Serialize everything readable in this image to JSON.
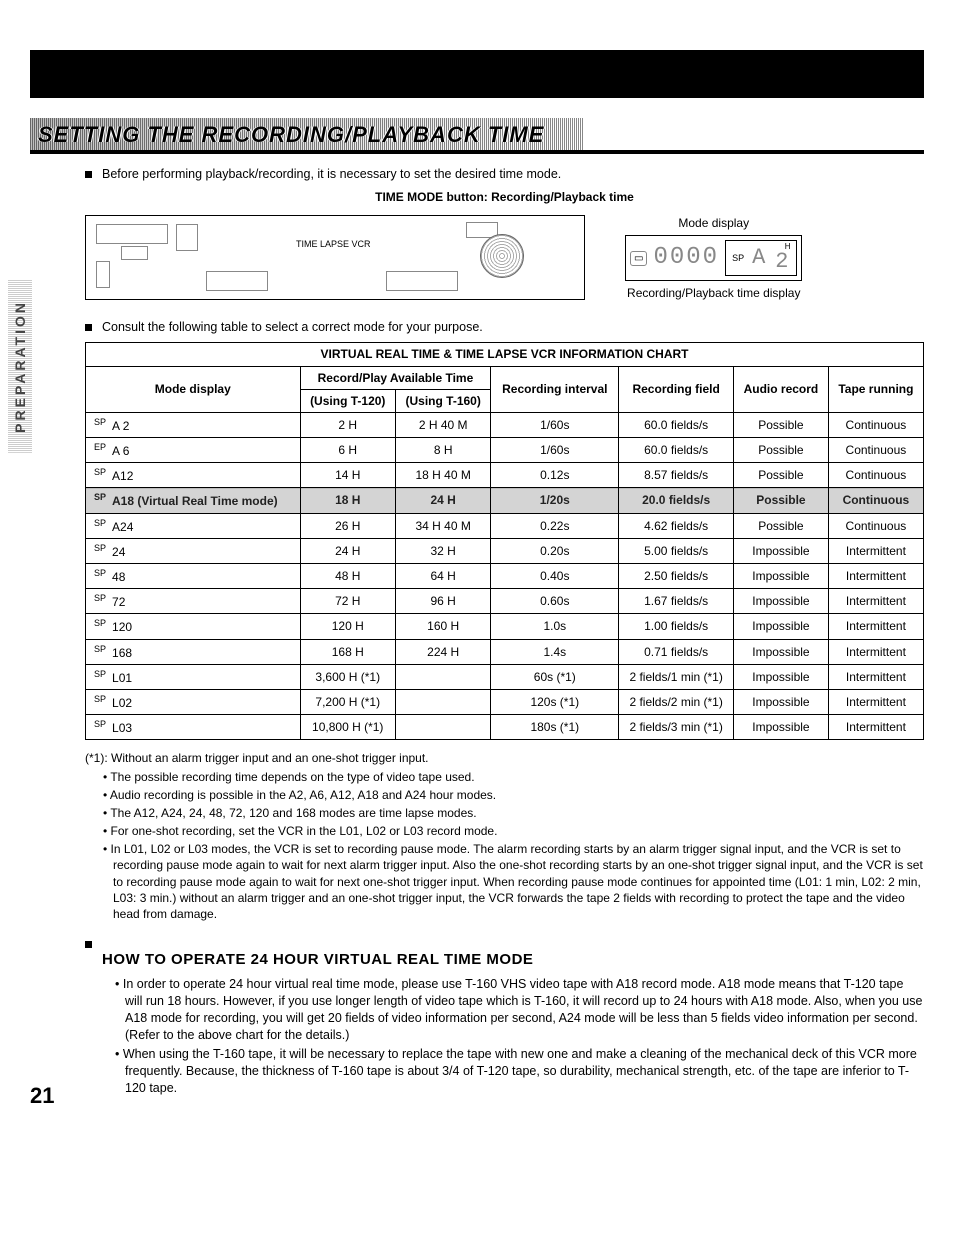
{
  "side_tab": "PREPARATION",
  "section_title": "SETTING THE RECORDING/PLAYBACK TIME",
  "intro1": "Before performing playback/recording, it is necessary to set the desired time mode.",
  "time_mode_line": "TIME MODE button: Recording/Playback time",
  "vcr_label": "TIME LAPSE VCR",
  "mode_display_label": "Mode display",
  "mode_display_segments": "0000",
  "mode_display_sp": "SP",
  "mode_display_a": "A",
  "mode_display_2": "2",
  "mode_display_h": "H",
  "mode_display_caption": "Recording/Playback time display",
  "intro2": "Consult the following table to select a correct mode for your purpose.",
  "table": {
    "title": "VIRTUAL REAL TIME & TIME LAPSE VCR INFORMATION CHART",
    "head_mode": "Mode display",
    "head_avail": "Record/Play Available Time",
    "head_t120": "(Using T-120)",
    "head_t160": "(Using T-160)",
    "head_interval": "Recording interval",
    "head_field": "Recording field",
    "head_audio": "Audio record",
    "head_tape": "Tape running",
    "rows": [
      {
        "sp": "SP",
        "mode": "A 2",
        "t120": "2 H",
        "t160": "2 H 40 M",
        "interval": "1/60s",
        "field": "60.0 fields/s",
        "audio": "Possible",
        "tape": "Continuous"
      },
      {
        "sp": "EP",
        "mode": "A 6",
        "t120": "6 H",
        "t160": "8 H",
        "interval": "1/60s",
        "field": "60.0 fields/s",
        "audio": "Possible",
        "tape": "Continuous"
      },
      {
        "sp": "SP",
        "mode": "A12",
        "t120": "14 H",
        "t160": "18 H 40 M",
        "interval": "0.12s",
        "field": "8.57 fields/s",
        "audio": "Possible",
        "tape": "Continuous"
      },
      {
        "sp": "SP",
        "mode": "A18 (Virtual Real Time mode)",
        "t120": "18 H",
        "t160": "24 H",
        "interval": "1/20s",
        "field": "20.0 fields/s",
        "audio": "Possible",
        "tape": "Continuous",
        "hl": true
      },
      {
        "sp": "SP",
        "mode": "A24",
        "t120": "26 H",
        "t160": "34 H 40 M",
        "interval": "0.22s",
        "field": "4.62 fields/s",
        "audio": "Possible",
        "tape": "Continuous"
      },
      {
        "sp": "SP",
        "mode": "24",
        "t120": "24 H",
        "t160": "32 H",
        "interval": "0.20s",
        "field": "5.00 fields/s",
        "audio": "Impossible",
        "tape": "Intermittent"
      },
      {
        "sp": "SP",
        "mode": "48",
        "t120": "48 H",
        "t160": "64 H",
        "interval": "0.40s",
        "field": "2.50 fields/s",
        "audio": "Impossible",
        "tape": "Intermittent"
      },
      {
        "sp": "SP",
        "mode": "72",
        "t120": "72 H",
        "t160": "96 H",
        "interval": "0.60s",
        "field": "1.67 fields/s",
        "audio": "Impossible",
        "tape": "Intermittent"
      },
      {
        "sp": "SP",
        "mode": "120",
        "t120": "120 H",
        "t160": "160 H",
        "interval": "1.0s",
        "field": "1.00 fields/s",
        "audio": "Impossible",
        "tape": "Intermittent"
      },
      {
        "sp": "SP",
        "mode": "168",
        "t120": "168 H",
        "t160": "224 H",
        "interval": "1.4s",
        "field": "0.71 fields/s",
        "audio": "Impossible",
        "tape": "Intermittent"
      },
      {
        "sp": "SP",
        "mode": "L01",
        "t120": "3,600 H (*1)",
        "t160": "",
        "interval": "60s (*1)",
        "field": "2 fields/1 min (*1)",
        "audio": "Impossible",
        "tape": "Intermittent"
      },
      {
        "sp": "SP",
        "mode": "L02",
        "t120": "7,200 H (*1)",
        "t160": "",
        "interval": "120s (*1)",
        "field": "2 fields/2 min (*1)",
        "audio": "Impossible",
        "tape": "Intermittent"
      },
      {
        "sp": "SP",
        "mode": "L03",
        "t120": "10,800 H (*1)",
        "t160": "",
        "interval": "180s (*1)",
        "field": "2 fields/3 min (*1)",
        "audio": "Impossible",
        "tape": "Intermittent"
      }
    ]
  },
  "footnote_lead": "(*1): Without an alarm trigger input and an one-shot trigger input.",
  "footnotes": [
    "The possible recording time depends on the type of video tape used.",
    "Audio recording is possible in the A2, A6, A12, A18 and A24 hour modes.",
    "The A12, A24, 24, 48, 72, 120 and 168 modes are time lapse modes.",
    "For one-shot recording, set the VCR in the L01, L02 or L03 record mode.",
    "In L01, L02 or L03 modes, the VCR is set to recording pause mode. The alarm recording starts by an alarm trigger signal input, and the VCR is set to recording pause mode again to wait for next alarm trigger input. Also the one-shot recording starts by an one-shot trigger signal input, and the VCR is set to recording pause mode again to wait for next one-shot trigger input. When recording pause mode continues for appointed time (L01: 1 min, L02: 2 min, L03: 3 min.) without an alarm trigger and an one-shot trigger input, the VCR forwards the tape 2 fields with recording to protect the tape and the video head from damage."
  ],
  "howto_title": "HOW TO OPERATE 24 HOUR VIRTUAL REAL TIME MODE",
  "howto": [
    "In order to operate 24 hour virtual real time mode, please use T-160 VHS video tape with A18 record mode. A18 mode means that T-120 tape will run 18 hours. However, if you use longer length of video tape which is T-160, it will record up to 24 hours with A18 mode. Also, when you use A18 mode for recording, you will get 20 fields of video information per second, A24 mode will be less than 5 fields video information per second. (Refer to the above chart for the details.)",
    "When using the T-160 tape, it will be necessary to replace the tape with new one and make a cleaning of the mechanical deck of this VCR more frequently. Because, the thickness of T-160 tape is about 3/4 of T-120 tape, so durability, mechanical strength, etc. of the tape are inferior to T-120 tape."
  ],
  "page_number": "21"
}
